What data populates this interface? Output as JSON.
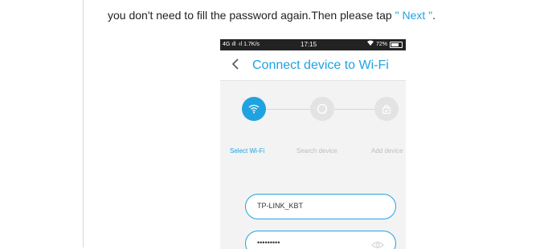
{
  "instruction": {
    "text_before": "you don't need to fill the password again.Then please tap ",
    "highlight": "\" Next \"",
    "text_after": "."
  },
  "status_bar": {
    "network": "4G",
    "speed": "1.7K/s",
    "time": "17:15",
    "battery": "72%"
  },
  "header": {
    "back_icon": "chevron-left-icon",
    "title": "Connect device to Wi-Fi"
  },
  "steps": [
    {
      "label": "Select Wi-Fi",
      "icon": "wifi-icon",
      "active": true
    },
    {
      "label": "Search device",
      "icon": "search-icon",
      "active": false
    },
    {
      "label": "Add device",
      "icon": "lock-icon",
      "active": false
    }
  ],
  "form": {
    "ssid_value": "TP-LINK_KBT",
    "password_value": "•••••••••",
    "password_toggle_icon": "eye-icon"
  },
  "colors": {
    "accent": "#1fa3e0",
    "inactive": "#bdbdbd"
  }
}
